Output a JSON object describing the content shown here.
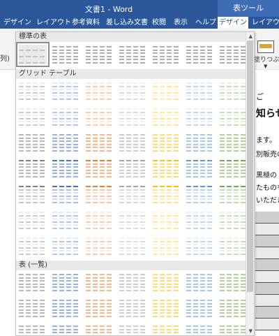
{
  "window": {
    "title": "文書1 - Word",
    "context_tab_group": "表ツール"
  },
  "tabs": [
    "デザイン",
    "レイアウト",
    "参考資料",
    "差し込み文書",
    "校閲",
    "表示",
    "ヘルプ",
    "デザイン",
    "レイアウト"
  ],
  "active_tab_index": 7,
  "ribbon": {
    "left_label": "列)",
    "right_button_label": "塗りつぶし"
  },
  "gallery": {
    "sections": [
      "標準の表",
      "グリッド テーブル",
      "表 (一覧)"
    ],
    "accent_colors": [
      "#7f7f7f",
      "#4472c4",
      "#ed7d31",
      "#a5a5a5",
      "#ffc000",
      "#5b9bd5",
      "#70ad47",
      "#8064a2"
    ]
  },
  "document": {
    "fragments": [
      "ご",
      "知らせ",
      "ます。",
      "別販売の",
      "黒極の",
      "たものを",
      "いただき"
    ]
  }
}
